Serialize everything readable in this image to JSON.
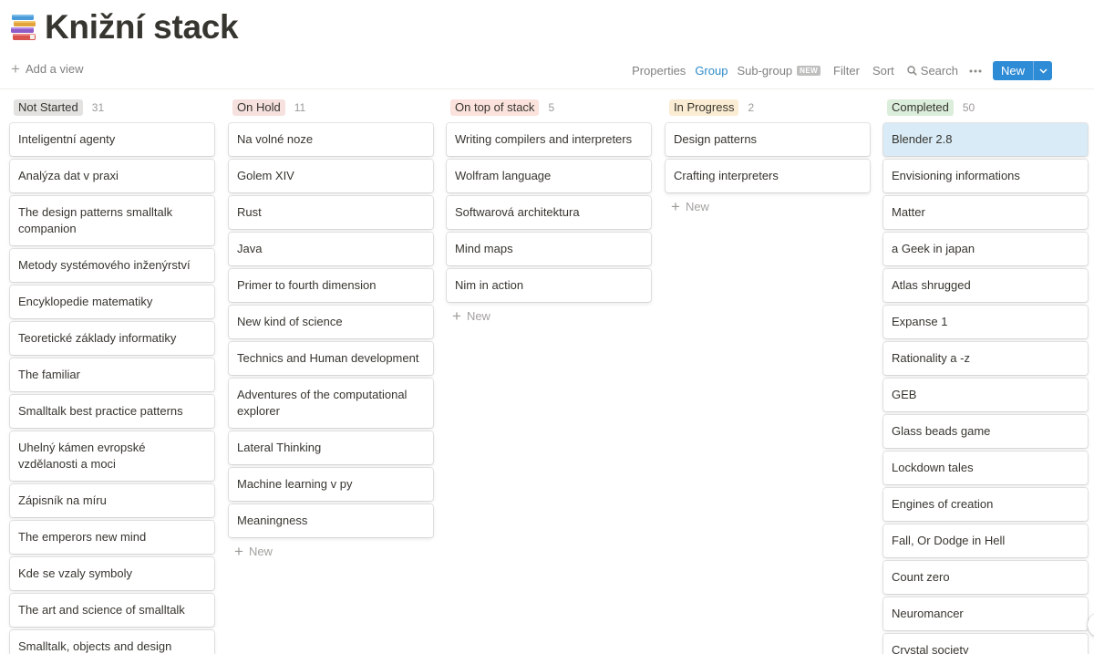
{
  "page": {
    "icon": "books-stack-icon",
    "title": "Knižní stack"
  },
  "toolbar": {
    "add_view": "Add a view",
    "properties": "Properties",
    "group": "Group",
    "subgroup": "Sub-group",
    "subgroup_badge": "NEW",
    "filter": "Filter",
    "sort": "Sort",
    "search": "Search",
    "more_icon": "ellipsis-icon",
    "new_button": "New",
    "accent_color": "#2e8bd6"
  },
  "board": {
    "new_item_label": "New",
    "columns": [
      {
        "label": "Not Started",
        "count": "31",
        "tag_color": "#e3e2e0",
        "cards": [
          "Inteligentní agenty",
          "Analýza dat v praxi",
          "The design patterns smalltalk companion",
          "Metody systémového inženýrství",
          "Encyklopedie matematiky",
          "Teoretické základy informatiky",
          "The familiar",
          "Smalltalk best practice patterns",
          "Uhelný kámen evropské vzdělanosti a moci",
          "Zápisník na míru",
          "The emperors new mind",
          "Kde se vzaly symboly",
          "The art and science of smalltalk",
          "Smalltalk, objects and design"
        ]
      },
      {
        "label": "On Hold",
        "count": "11",
        "tag_color": "#f6e1de",
        "cards": [
          "Na volné noze",
          "Golem XIV",
          "Rust",
          "Java",
          "Primer to fourth dimension",
          "New kind of science",
          "Technics and Human development",
          "Adventures of the computational explorer",
          "Lateral Thinking",
          "Machine learning v py",
          "Meaningness"
        ]
      },
      {
        "label": "On top of stack",
        "count": "5",
        "tag_color": "#fbe2dd",
        "cards": [
          "Writing compilers and interpreters",
          "Wolfram language",
          "Softwarová architektura",
          "Mind maps",
          "Nim in action"
        ]
      },
      {
        "label": "In Progress",
        "count": "2",
        "tag_color": "#fbedd3",
        "cards": [
          "Design patterns",
          "Crafting interpreters"
        ]
      },
      {
        "label": "Completed",
        "count": "50",
        "tag_color": "#dbeddb",
        "cards": [
          "Blender 2.8",
          "Envisioning informations",
          "Matter",
          "a Geek in japan",
          "Atlas shrugged",
          "Expanse 1",
          "Rationality a -z",
          "GEB",
          "Glass beads game",
          "Lockdown tales",
          "Engines of creation",
          "Fall, Or Dodge in Hell",
          "Count zero",
          "Neuromancer",
          "Crystal society"
        ]
      }
    ]
  }
}
